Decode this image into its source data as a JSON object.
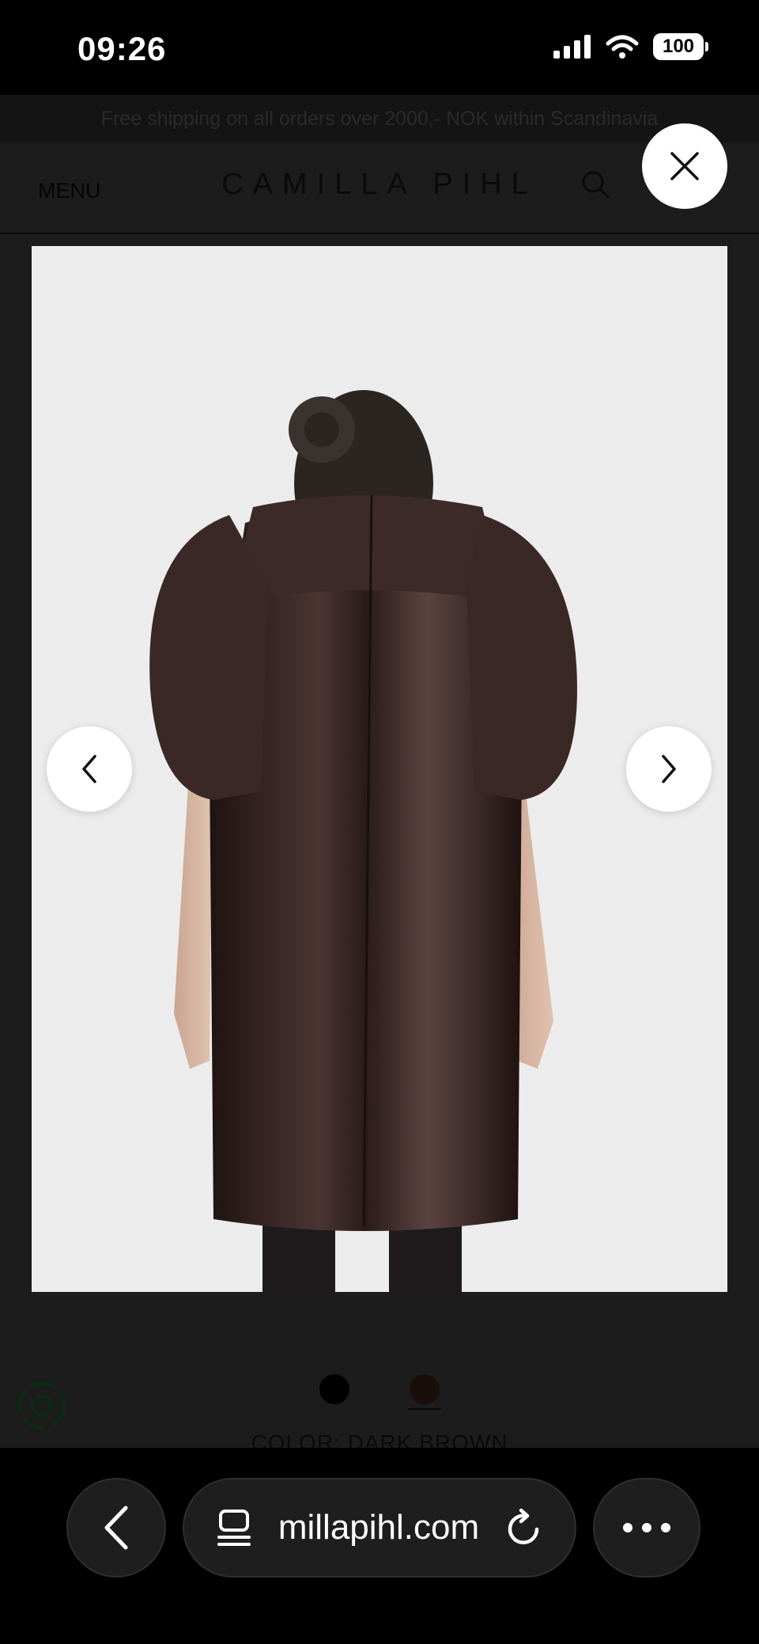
{
  "status_bar": {
    "time": "09:26",
    "battery": "100"
  },
  "site": {
    "promo": "Free shipping on all orders over 2000,- NOK within Scandinavia",
    "menu_label": "MENU",
    "logo": "CAMILLA PIHL",
    "color_label": "COLOR: DARK BROWN"
  },
  "browser": {
    "url": "millapihl.com"
  },
  "colors": {
    "dress": "#2d1c1a",
    "image_bg": "#ececec",
    "overlay": "#1c1c1c"
  },
  "icons": [
    "signal-icon",
    "wifi-icon",
    "battery-icon",
    "close-icon",
    "chevron-left-icon",
    "chevron-right-icon",
    "search-icon",
    "back-icon",
    "tabs-icon",
    "reload-icon",
    "more-icon"
  ]
}
